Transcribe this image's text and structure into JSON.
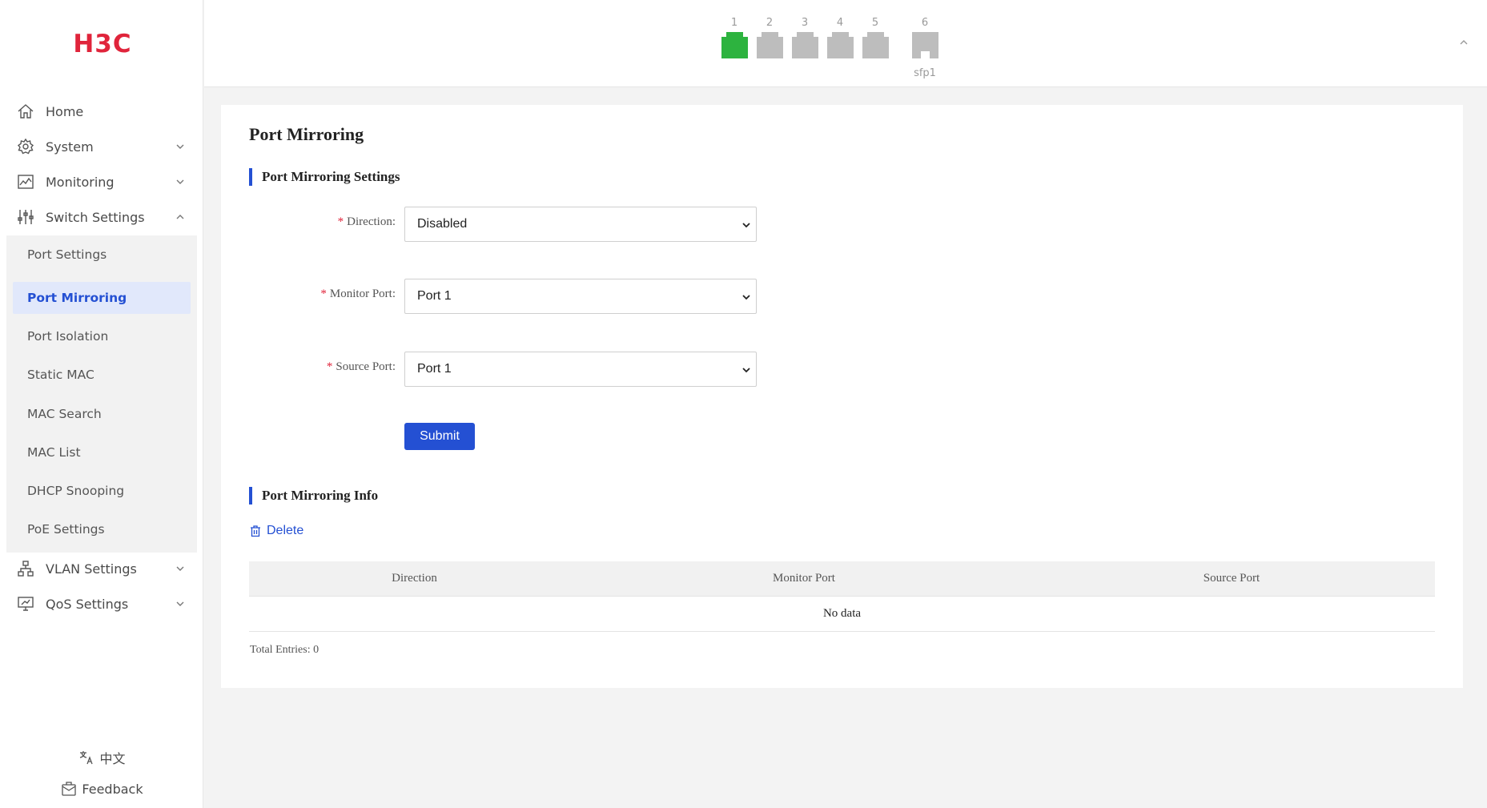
{
  "brand": {
    "logo_text": "H3C",
    "color": "#e0243b"
  },
  "sidebar": {
    "items": [
      {
        "label": "Home",
        "icon": "home-icon"
      },
      {
        "label": "System",
        "icon": "gear-icon"
      },
      {
        "label": "Monitoring",
        "icon": "chart-icon"
      },
      {
        "label": "Switch Settings",
        "icon": "sliders-icon"
      },
      {
        "label": "VLAN Settings",
        "icon": "network-icon"
      },
      {
        "label": "QoS Settings",
        "icon": "monitor-icon"
      }
    ],
    "submenu": [
      {
        "label": "Port Settings"
      },
      {
        "label": "Port Mirroring",
        "active": true
      },
      {
        "label": "Port Isolation"
      },
      {
        "label": "Static MAC"
      },
      {
        "label": "MAC Search"
      },
      {
        "label": "MAC List"
      },
      {
        "label": "DHCP Snooping"
      },
      {
        "label": "PoE Settings"
      }
    ],
    "language_label": "中文",
    "feedback_label": "Feedback"
  },
  "header": {
    "ports": [
      {
        "number": "1",
        "status": "up",
        "color": "#2db33f"
      },
      {
        "number": "2",
        "status": "down",
        "color": "#bdbdbd"
      },
      {
        "number": "3",
        "status": "down",
        "color": "#bdbdbd"
      },
      {
        "number": "4",
        "status": "down",
        "color": "#bdbdbd"
      },
      {
        "number": "5",
        "status": "down",
        "color": "#bdbdbd"
      },
      {
        "number": "6",
        "status": "down",
        "color": "#bdbdbd",
        "label": "sfp1"
      }
    ]
  },
  "main": {
    "title": "Port Mirroring",
    "settings_section": "Port Mirroring Settings",
    "form": {
      "direction_label": "Direction:",
      "direction_value": "Disabled",
      "monitor_port_label": "Monitor Port:",
      "monitor_port_value": "Port 1",
      "source_port_label": "Source Port:",
      "source_port_value": "Port 1",
      "submit_label": "Submit"
    },
    "info_section": "Port Mirroring Info",
    "delete_label": "Delete",
    "table": {
      "columns": [
        "Direction",
        "Monitor Port",
        "Source Port"
      ],
      "empty_text": "No data"
    },
    "total_entries": "Total Entries: 0"
  },
  "colors": {
    "accent": "#2450d3",
    "required": "#e0243b"
  }
}
